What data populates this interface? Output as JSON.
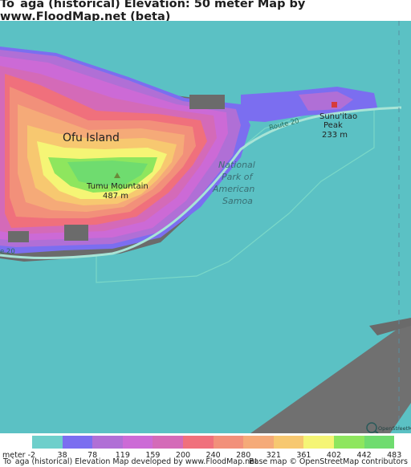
{
  "title": "To`aga (historical) Elevation: 50 meter Map by www.FloodMap.net (beta)",
  "map": {
    "sea_color": "#5bc1c4",
    "labels": {
      "island": "Ofu Island",
      "mountain_name": "Tumu Mountain",
      "mountain_elev": "487 m",
      "peak_name_1": "Sunu'itao",
      "peak_name_2": "Peak",
      "peak_elev": "233 m",
      "park_1": "National",
      "park_2": "Park of",
      "park_3": "American",
      "park_4": "Samoa",
      "route_east": "Route 20",
      "route_west": "e 20",
      "osm_logo": "OpenStreetMap"
    },
    "icons": [
      "mountain-peak-icon",
      "peak-marker-icon",
      "osm-logo-icon"
    ]
  },
  "legend": {
    "unit_label": "meter -2",
    "values": [
      "38",
      "78",
      "119",
      "159",
      "200",
      "240",
      "280",
      "321",
      "361",
      "402",
      "442",
      "483"
    ],
    "colors": [
      "#6ecfcb",
      "#7b6ef0",
      "#b06fd6",
      "#cc6ad6",
      "#d46ab8",
      "#f0707c",
      "#f2907a",
      "#f5aa78",
      "#f7c870",
      "#f5f575",
      "#8ee65e",
      "#6fdc6f"
    ]
  },
  "footer": {
    "left": "To`aga (historical) Elevation Map developed by www.FloodMap.net",
    "right": "Base map © OpenStreetMap contributors"
  }
}
